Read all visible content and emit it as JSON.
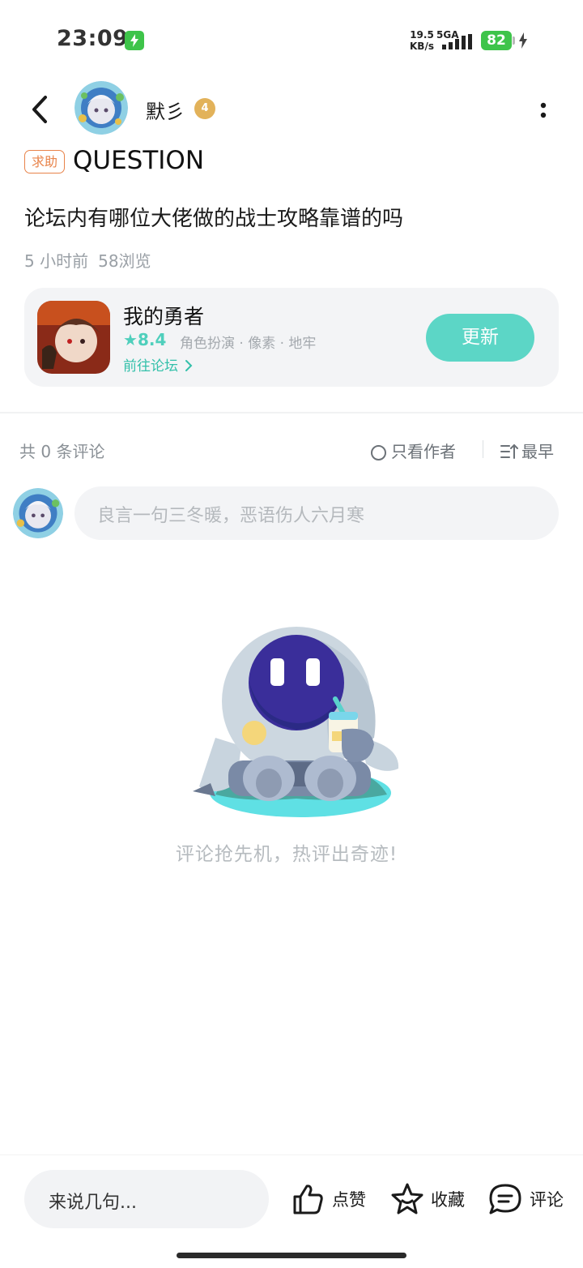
{
  "status_bar": {
    "time": "23:09",
    "net_speed_value": "19.5",
    "net_speed_unit": "KB/s",
    "network_type": "5GA",
    "battery": "82"
  },
  "header": {
    "author_name": "默彡",
    "level_badge": "4"
  },
  "post": {
    "tag": "求助",
    "type_label": "QUESTION",
    "title": "论坛内有哪位大佬做的战士攻略靠谱的吗",
    "time_ago": "5 小时前",
    "views": "58浏览"
  },
  "game_card": {
    "name": "我的勇者",
    "rating": "8.4",
    "tags": "角色扮演 · 像素 · 地牢",
    "forum_link": "前往论坛",
    "action_label": "更新"
  },
  "comments": {
    "count_text": "共 0 条评论",
    "author_only": "只看作者",
    "sort": "最早",
    "input_placeholder": "良言一句三冬暖，恶语伤人六月寒",
    "empty_text": "评论抢先机，热评出奇迹!"
  },
  "bottom_bar": {
    "input_placeholder": "来说几句...",
    "like": "点赞",
    "favorite": "收藏",
    "comment": "评论"
  },
  "colors": {
    "accent": "#5cd6c6",
    "tag": "#e8834a",
    "battery": "#3ec44a"
  },
  "icons": [
    "back-arrow-icon",
    "more-icon",
    "star-icon",
    "chevron-right-icon",
    "sort-icon",
    "thumbs-up-icon",
    "favorite-star-icon",
    "comment-bubble-icon",
    "charging-icon"
  ]
}
